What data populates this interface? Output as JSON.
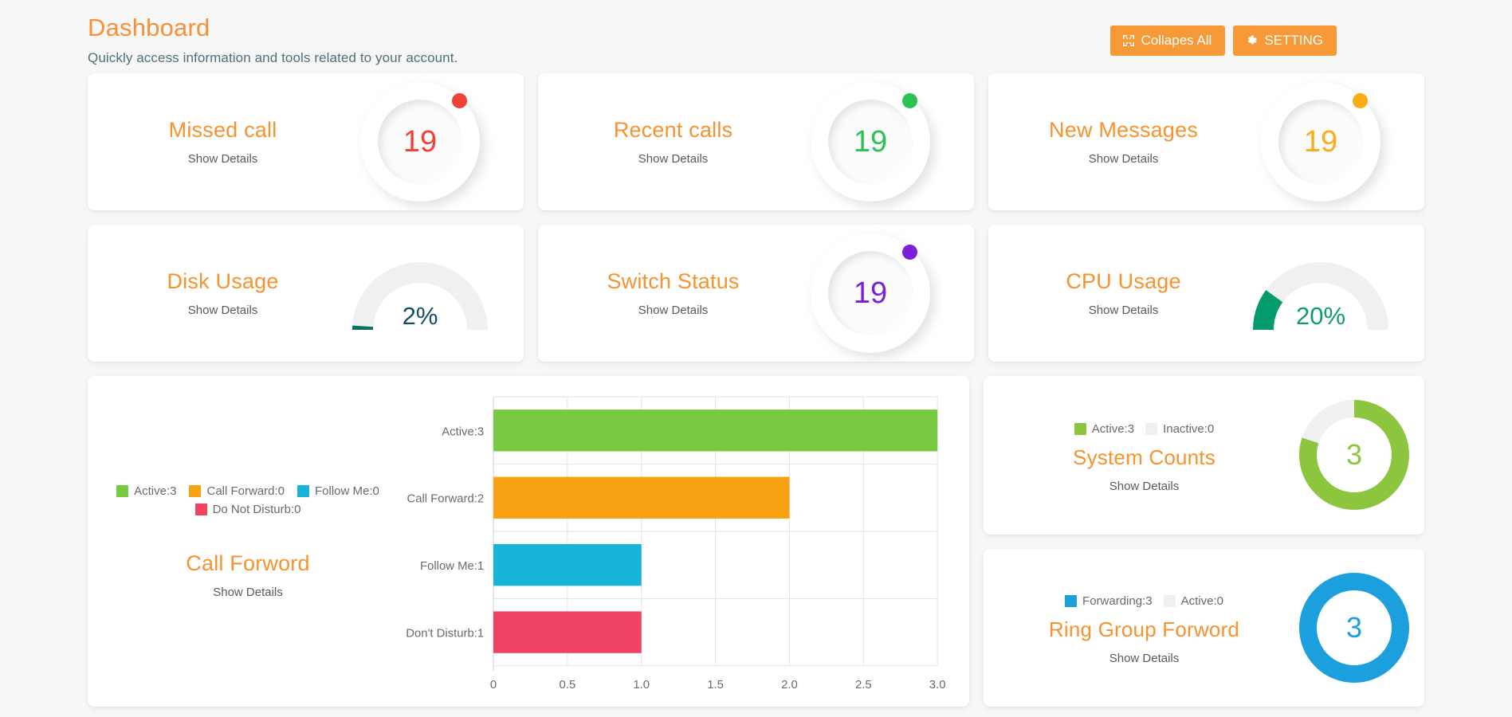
{
  "header": {
    "title": "Dashboard",
    "subtitle": "Quickly access information and tools related to your account.",
    "collapse_button": "Collapes All",
    "setting_button": "SETTING"
  },
  "theme": {
    "brand_orange": "#f7922f",
    "button_orange": "#f89938",
    "subtitle_blue": "#4f6f7e",
    "muted_text": "#5a5a5a",
    "page_bg": "#f7f7f7",
    "card_bg": "#ffffff"
  },
  "stat_cards": [
    {
      "title": "Missed call",
      "link": "Show Details",
      "value": "19",
      "color": "#ef4136",
      "gauge": "ring"
    },
    {
      "title": "Recent calls",
      "link": "Show Details",
      "value": "19",
      "color": "#2cc253",
      "gauge": "ring"
    },
    {
      "title": "New Messages",
      "link": "Show Details",
      "value": "19",
      "color": "#fbab18",
      "gauge": "ring"
    },
    {
      "title": "Disk Usage",
      "link": "Show Details",
      "value": "2%",
      "percent": 2,
      "color": "#134f63",
      "arc_color": "#0e6f63",
      "track_color": "#f0f0f0",
      "gauge": "semicircle"
    },
    {
      "title": "Switch Status",
      "link": "Show Details",
      "value": "19",
      "color": "#7b20d6",
      "gauge": "ring"
    },
    {
      "title": "CPU Usage",
      "link": "Show Details",
      "value": "20%",
      "percent": 20,
      "color": "#0f9b6e",
      "arc_color": "#059b6c",
      "track_color": "#f0f0f0",
      "gauge": "semicircle"
    }
  ],
  "call_forward_panel": {
    "title": "Call Forword",
    "link": "Show Details",
    "legend": [
      {
        "label": "Active:3",
        "color": "#7ac943"
      },
      {
        "label": "Call Forward:0",
        "color": "#f7a113"
      },
      {
        "label": "Follow Me:0",
        "color": "#18b4d7"
      },
      {
        "label": "Do Not Disturb:0",
        "color": "#f04263"
      }
    ]
  },
  "chart_data": {
    "type": "bar",
    "orientation": "horizontal",
    "title": "Call Forword",
    "xlabel": "",
    "ylabel": "",
    "categories": [
      "Active:3",
      "Call Forward:2",
      "Follow Me:1",
      "Don't Disturb:1"
    ],
    "values": [
      3.0,
      2.0,
      1.0,
      1.0
    ],
    "colors": [
      "#7ac943",
      "#f7a113",
      "#18b4d7",
      "#f04263"
    ],
    "xlim": [
      0,
      3
    ],
    "xticks": [
      "0",
      "0.5",
      "1.0",
      "1.5",
      "2.0",
      "2.5",
      "3.0"
    ],
    "xtick_values": [
      0,
      0.5,
      1.0,
      1.5,
      2.0,
      2.5,
      3.0
    ],
    "grid": true,
    "legend": [
      "Active:3",
      "Call Forward:0",
      "Follow Me:0",
      "Do Not Disturb:0"
    ],
    "legend_position": "left"
  },
  "side_cards": [
    {
      "title": "System Counts",
      "link": "Show Details",
      "value": "3",
      "value_color": "#8cc63e",
      "legend": [
        {
          "label": "Active:3",
          "color": "#8cc63e"
        },
        {
          "label": "Inactive:0",
          "color": "#f0f0f0"
        }
      ],
      "donut": {
        "filled_percent": 80,
        "fill_color": "#8cc63e",
        "track_color": "#f0f0f0"
      }
    },
    {
      "title": "Ring Group Forword",
      "link": "Show Details",
      "value": "3",
      "value_color": "#1b9fdd",
      "legend": [
        {
          "label": "Forwarding:3",
          "color": "#1b9fdd"
        },
        {
          "label": "Active:0",
          "color": "#f0f0f0"
        }
      ],
      "donut": {
        "filled_percent": 100,
        "fill_color": "#1b9fdd",
        "track_color": "#f0f0f0"
      }
    }
  ]
}
